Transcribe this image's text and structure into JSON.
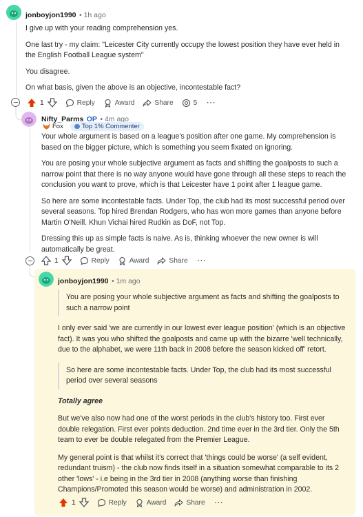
{
  "comment1": {
    "username": "jonboyjon1990",
    "time": "1h ago",
    "paragraphs": [
      "I give up with your reading comprehension yes.",
      "One last try - my claim: \"Leicester City currently occupy the lowest position they have ever held in the English Football League system\"",
      "You disagree.",
      "On what basis, given the above is an objective, incontestable fact?"
    ],
    "actions": {
      "votes": "1",
      "reply": "Reply",
      "award": "Award",
      "share": "Share",
      "awards_count": "5"
    }
  },
  "comment2": {
    "username": "Nifty_Parms",
    "op_label": "OP",
    "time": "4m ago",
    "flair_fox": "Fox",
    "flair_commenter": "Top 1% Commenter",
    "paragraphs": [
      "Your whole argument is based on a league's position after one game. My comprehension is based on the bigger picture, which is something you seem fixated on ignoring.",
      "You are posing your whole subjective argument as facts and shifting the goalposts to such a narrow point that there is no way anyone would have gone through all these steps to reach the conclusion you want to prove, which is that Leicester have 1 point after 1 league game.",
      "So here are some incontestable facts. Under Top, the club had its most successful period over several seasons. Top hired Brendan Rodgers, who has won more games than anyone before Martin O'Neill. Khun Vichai hired Rudkin as DoF, not Top.",
      "Dressing this up as simple facts is naive. As is, thinking whoever the new owner is will automatically be great."
    ],
    "actions": {
      "votes": "1",
      "reply": "Reply",
      "award": "Award",
      "share": "Share"
    }
  },
  "comment3": {
    "username": "jonboyjon1990",
    "time": "1m ago",
    "quote1": "You are posing your whole subjective argument as facts and shifting the goalposts to such a narrow point",
    "para1": "I only ever said 'we are currently in our lowest ever league position' (which is an objective fact). It was you who shifted the goalposts and came up with the bizarre 'well technically, due to the alphabet, we were 11th back in 2008 before the season kicked off' retort.",
    "quote2": "So here are some incontestable facts. Under Top, the club had its most successful period over several seasons",
    "emphasis": "Totally agree",
    "para2": "But we've also now had one of the worst periods in the club's history too. First ever double relegation. First ever points deduction. 2nd time ever in the 3rd tier. Only the 5th team to ever be double relegated from the Premier League.",
    "para3": "My general point is that whilst it's correct that 'things could be worse' (a self evident, redundant truism) - the club now finds itself in a situation somewhat comparable to its 2 other 'lows' - i.e being in the 3rd tier in 2008 (anything worse than finishing Champions/Promoted this season would be worse) and administration in 2002.",
    "actions": {
      "votes": "1",
      "reply": "Reply",
      "award": "Award",
      "share": "Share"
    }
  },
  "colors": {
    "upvote": "#d93a00",
    "highlight": "#fdf7dd",
    "op": "#2a63c4"
  }
}
